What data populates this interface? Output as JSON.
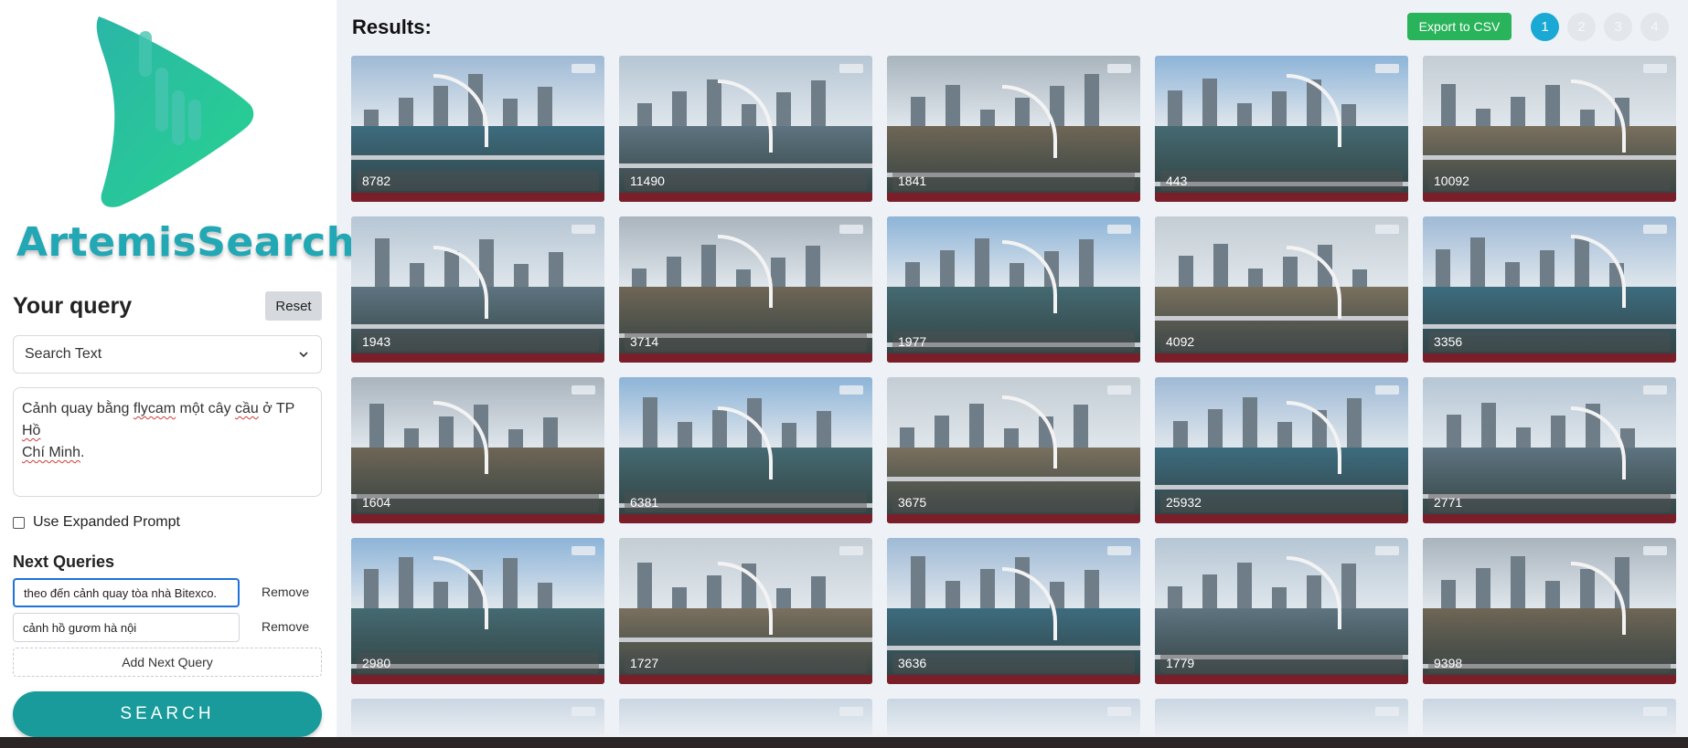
{
  "brand": {
    "name": "ArtemisSearch",
    "color": "#22a7b4"
  },
  "query": {
    "title": "Your query",
    "reset_label": "Reset",
    "mode": "Search Text",
    "text_plain": "Cảnh quay bằng ",
    "text_spell_1": "flycam",
    "text_mid": " một cây ",
    "text_spell_2": "cầu",
    "text_mid2": " ở TP ",
    "text_spell_3": "Hồ",
    "text_line2_a": "",
    "text_spell_4": "Chí Minh",
    "text_end": ".",
    "expanded_label": "Use Expanded Prompt",
    "expanded_checked": false
  },
  "next_queries": {
    "title": "Next Queries",
    "items": [
      {
        "value": "theo đến cảnh quay tòa nhà Bitexco.",
        "remove_label": "Remove"
      },
      {
        "value": "cảnh hồ gươm hà nội",
        "remove_label": "Remove"
      }
    ],
    "add_label": "Add Next Query"
  },
  "search_label": "SEARCH",
  "results": {
    "title": "Results:",
    "export_label": "Export to CSV",
    "pages": [
      "1",
      "2",
      "3",
      "4"
    ],
    "active_page": "1",
    "items": [
      "8782",
      "11490",
      "1841",
      "443",
      "10092",
      "1943",
      "3714",
      "1977",
      "4092",
      "3356",
      "1604",
      "6381",
      "3675",
      "25932",
      "2771",
      "2980",
      "1727",
      "3636",
      "1779",
      "9398"
    ]
  },
  "colors": {
    "accent": "#189b9a",
    "export": "#29b35a",
    "page_active": "#19a9d4"
  }
}
